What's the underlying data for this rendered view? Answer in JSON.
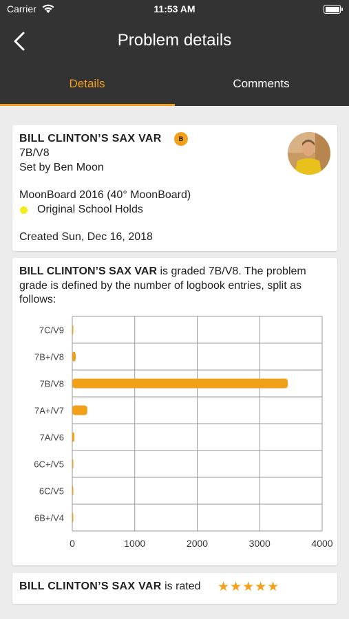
{
  "status_bar": {
    "carrier": "Carrier",
    "time": "11:53 AM"
  },
  "nav": {
    "title": "Problem details"
  },
  "tabs": [
    {
      "label": "Details",
      "active": true
    },
    {
      "label": "Comments",
      "active": false
    }
  ],
  "problem": {
    "name": "BILL CLINTON’S SAX VAR",
    "badge": "B",
    "grade": "7B/V8",
    "setter": "Set by Ben Moon",
    "board": "MoonBoard 2016 (40° MoonBoard)",
    "holds": "Original School Holds",
    "holds_color": "#f4ec1a",
    "created": "Created Sun, Dec 16, 2018"
  },
  "grade_info": {
    "name": "BILL CLINTON’S SAX VAR",
    "text": " is graded 7B/V8. The problem grade is defined by the number of logbook entries, split as follows:"
  },
  "chart_data": {
    "type": "bar",
    "orientation": "horizontal",
    "categories": [
      "7C/V9",
      "7B+/V8",
      "7B/V8",
      "7A+/V7",
      "7A/V6",
      "6C+/V5",
      "6C/V5",
      "6B+/V4"
    ],
    "values": [
      5,
      55,
      3450,
      240,
      35,
      3,
      3,
      3
    ],
    "xlim": [
      0,
      4000
    ],
    "xticks": [
      "0",
      "1000",
      "2000",
      "3000",
      "4000"
    ],
    "grid": true,
    "bar_color": "#f2a019"
  },
  "rating": {
    "name": "BILL CLINTON’S SAX VAR",
    "text": " is rated",
    "stars": "★★★★★",
    "stars_value": 5
  },
  "colors": {
    "accent": "#f2a019",
    "header": "#333333",
    "background": "#ececec"
  }
}
